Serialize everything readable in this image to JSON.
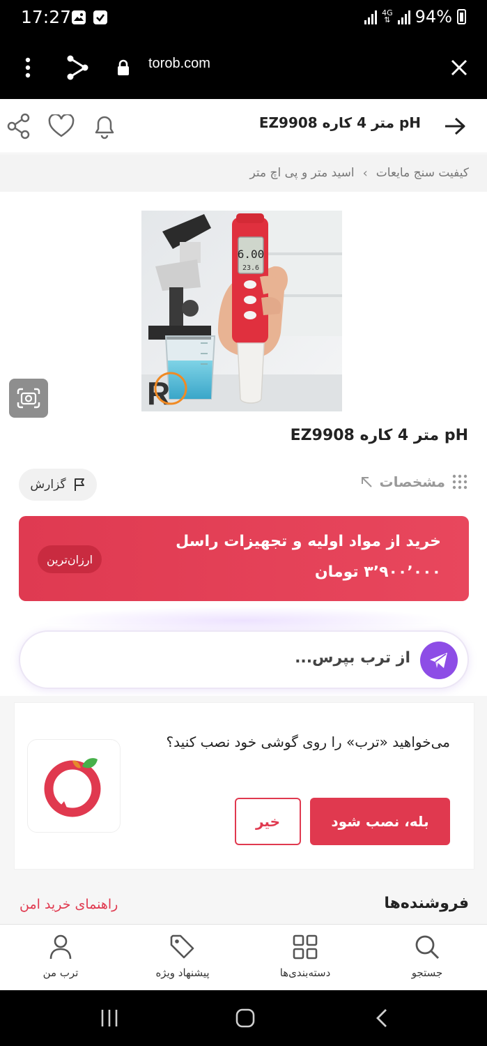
{
  "status_bar": {
    "time": "17:27",
    "network": "4G",
    "battery": "94%"
  },
  "browser": {
    "url": "torob.com",
    "icons": [
      "menu-icon",
      "share-icon",
      "lock-icon",
      "close-icon"
    ]
  },
  "header": {
    "title": "pH متر 4 کاره EZ9908",
    "icons": [
      "back-arrow-icon",
      "bell-icon",
      "heart-icon",
      "share-icon"
    ]
  },
  "breadcrumb": {
    "items": [
      "کیفیت سنج مایعات",
      "اسید متر و پی اچ متر"
    ],
    "separator": "›"
  },
  "product": {
    "title": "pH متر 4 کاره EZ9908",
    "image_description": "Red and white pH meter pen held in a hand, with microscope and beaker in background",
    "lcd_value": "6.00",
    "lcd_temp": "23.6",
    "watermark": "R"
  },
  "actions": {
    "specs_label": "مشخصات",
    "report_label": "گزارش"
  },
  "offer": {
    "store": "خرید از مواد اولیه و تجهیزات راسل",
    "price": "۳٬۹۰۰٬۰۰۰ تومان",
    "badge": "ارزان‌ترین",
    "color": "#e0394f"
  },
  "ask": {
    "placeholder": "از ترب بپرس..."
  },
  "install": {
    "question": "می‌خواهید «ترب» را روی گوشی خود نصب کنید؟",
    "yes_label": "بله، نصب شود",
    "no_label": "خیر"
  },
  "sellers": {
    "title": "فروشنده‌ها",
    "safe_guide": "راهنمای خرید امن"
  },
  "bottom_nav": {
    "items": [
      {
        "label": "جستجو",
        "icon": "search-icon"
      },
      {
        "label": "دسته‌بندی‌ها",
        "icon": "grid-icon"
      },
      {
        "label": "پیشنهاد ویژه",
        "icon": "tag-icon"
      },
      {
        "label": "ترب من",
        "icon": "user-icon"
      }
    ]
  },
  "system_nav": {
    "icons": [
      "recents-icon",
      "home-icon",
      "back-icon"
    ]
  }
}
